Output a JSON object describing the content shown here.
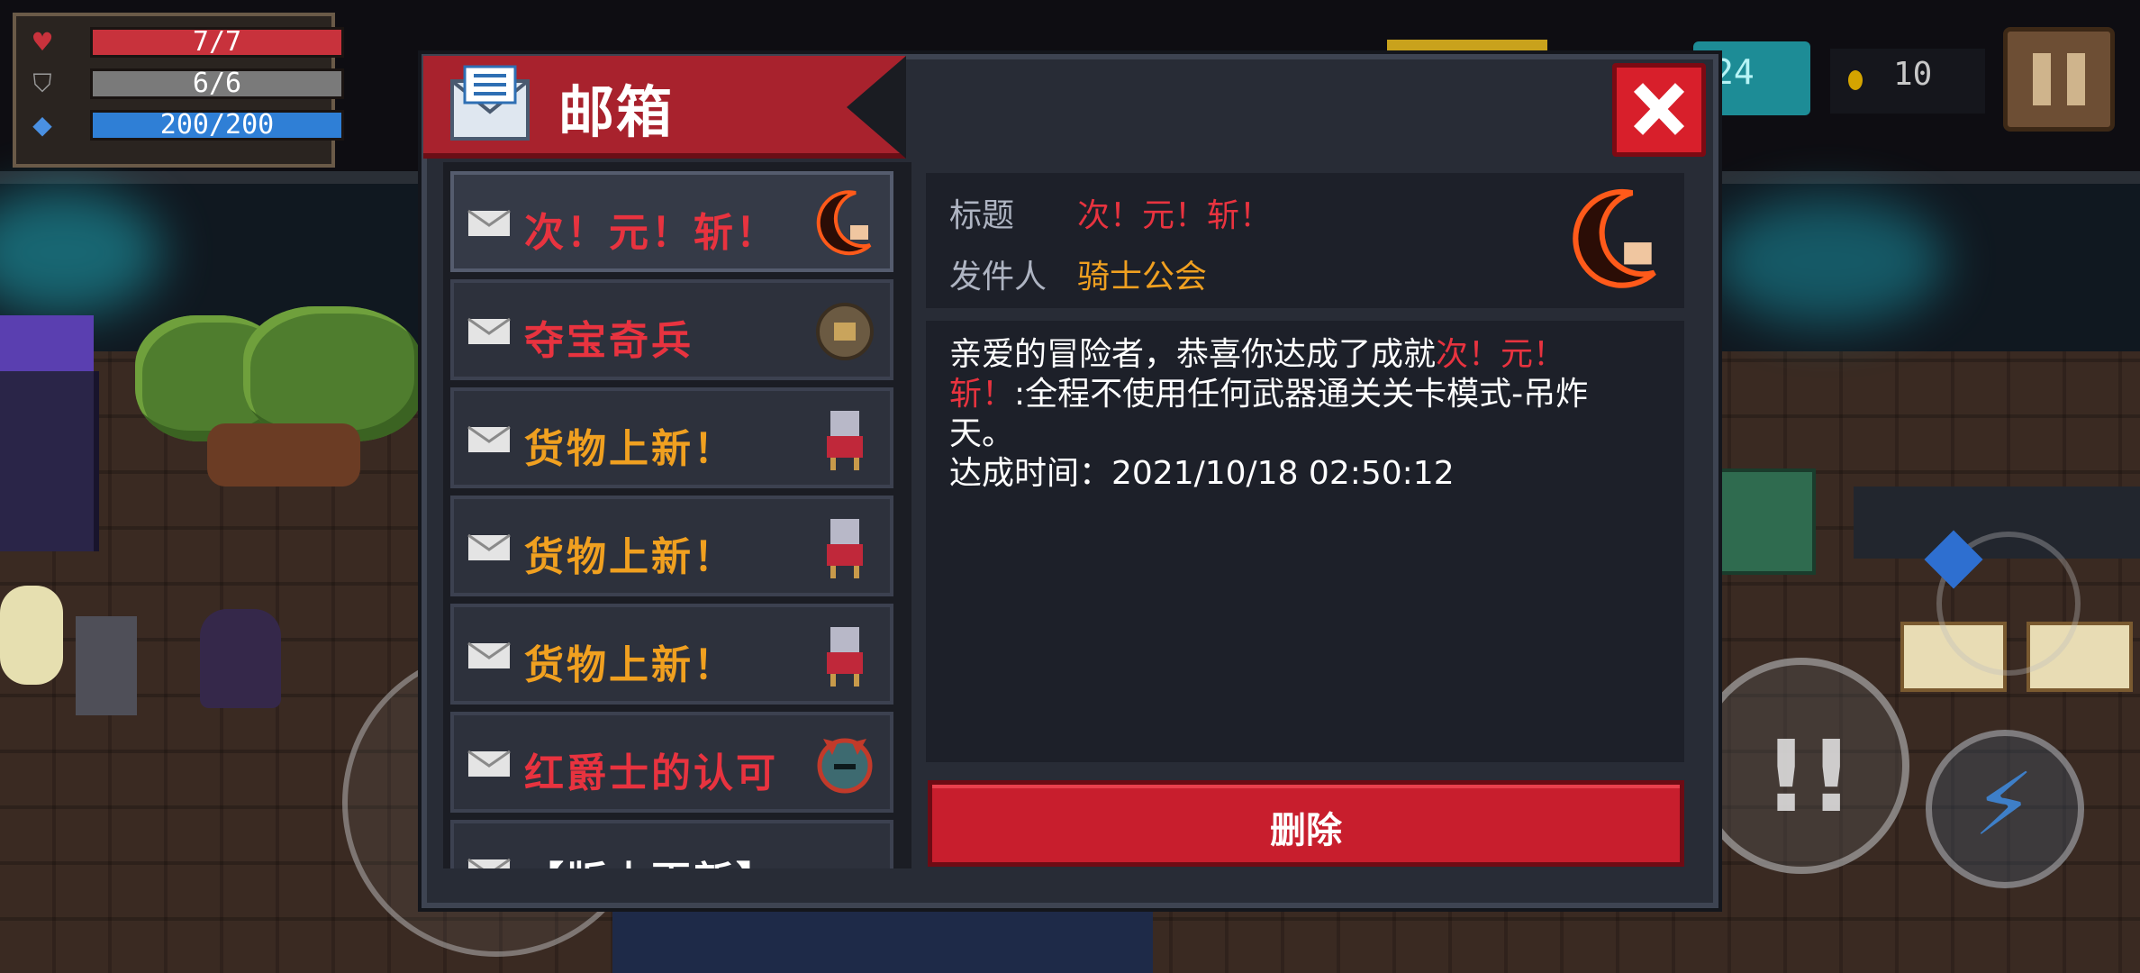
{
  "hud": {
    "health": "7/7",
    "armor": "6/6",
    "energy": "200/200",
    "gems": "24",
    "coins": "10",
    "health_icon": "heart-icon",
    "armor_icon": "shield-icon",
    "energy_icon": "diamond-icon",
    "pause_icon": "pause-icon"
  },
  "colors": {
    "health": "#c8323c",
    "armor": "#7a7a7a",
    "energy": "#2f7fd6",
    "red_title": "#e8333f",
    "orange_title": "#f0a020",
    "ribbon": "#a8222d",
    "delete": "#c81e2d"
  },
  "mailbox": {
    "title": "邮箱",
    "close_icon": "close-icon",
    "items": [
      {
        "title": "次！元！斩！",
        "color": "red",
        "thumb": "crescent-blade-icon"
      },
      {
        "title": "夺宝奇兵",
        "color": "red",
        "thumb": "treasure-orb-icon"
      },
      {
        "title": "货物上新！",
        "color": "orange",
        "thumb": "merchant-icon"
      },
      {
        "title": "货物上新！",
        "color": "orange",
        "thumb": "merchant-icon"
      },
      {
        "title": "货物上新！",
        "color": "orange",
        "thumb": "merchant-icon"
      },
      {
        "title": "红爵士的认可",
        "color": "red",
        "thumb": "red-knight-helmet-icon"
      },
      {
        "title": "【版本更新】",
        "color": "white",
        "thumb": ""
      }
    ],
    "detail": {
      "title_label": "标题",
      "title_value": "次！元！斩！",
      "sender_label": "发件人",
      "sender_value": "骑士公会",
      "body_prefix": "亲爱的冒险者，恭喜你达成了成就",
      "body_achievement": "次！元！斩！",
      "body_suffix": ":全程不使用任何武器通关关卡模式-吊炸天。",
      "achieved_time": "达成时间：2021/10/18 02:50:12"
    },
    "delete_label": "删除"
  }
}
